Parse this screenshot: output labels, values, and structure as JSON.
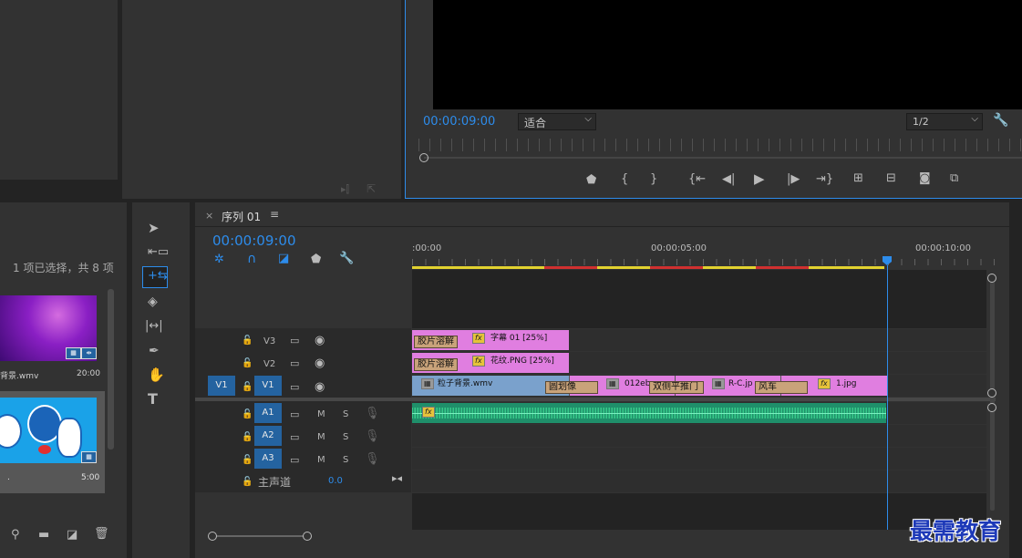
{
  "program_monitor": {
    "timecode": "00:00:09:00",
    "fit_select": "适合",
    "resolution_select": "1/2",
    "controls": [
      "marker-icon",
      "mark-in-icon",
      "mark-out-icon",
      "go-to-in-icon",
      "step-back-icon",
      "play-icon",
      "step-forward-icon",
      "go-to-out-icon",
      "lift-icon",
      "extract-icon",
      "camera-icon",
      "compare-icon"
    ]
  },
  "project_panel": {
    "selection_status": "1 项已选择，共 8 项",
    "items": [
      {
        "name": "背景.wmv",
        "duration": "20:00",
        "selected": true
      },
      {
        "name": ".",
        "duration": "5:00",
        "selected": false
      }
    ]
  },
  "tools": [
    "selection-tool-icon",
    "track-select-tool-icon",
    "ripple-edit-tool-icon",
    "razor-tool-icon",
    "slip-tool-icon",
    "pen-tool-icon",
    "hand-tool-icon",
    "type-tool-icon"
  ],
  "sequence": {
    "tab_close": "×",
    "tab_name": "序列 01",
    "tab_menu": "≡",
    "timecode": "00:00:09:00",
    "ruler_labels": [
      ":00:00",
      "00:00:05:00",
      "00:00:10:00"
    ],
    "tracks_video": [
      {
        "name": "V3",
        "source": ""
      },
      {
        "name": "V2",
        "source": ""
      },
      {
        "name": "V1",
        "source": "V1"
      }
    ],
    "tracks_audio": [
      {
        "name": "A1",
        "m": "M",
        "s": "S"
      },
      {
        "name": "A2",
        "m": "M",
        "s": "S"
      },
      {
        "name": "A3",
        "m": "M",
        "s": "S"
      }
    ],
    "master": {
      "label": "主声道",
      "value": "0.0"
    },
    "clips": {
      "v3_trans": "胶片溶解",
      "v3_clip": "字幕 01 [25%]",
      "v2_trans": "胶片溶解",
      "v2_clip": "花纹.PNG [25%]",
      "v1_clip1": "粒子背景.wmv",
      "v1_trans1": "圆划像",
      "v1_clip2": "012eb",
      "v1_trans2": "双侧平推门",
      "v1_clip3": "R-C.jp",
      "v1_trans3": "风车",
      "v1_clip4": "1.jpg",
      "fx": "fx"
    }
  },
  "watermark": "最需教育",
  "colors": {
    "accent_blue": "#2d8ceb",
    "clip_pink": "#e07ee0",
    "clip_blue": "#7aa1cc",
    "audio_green": "#1f8f6a",
    "track_target": "#2463a0"
  }
}
